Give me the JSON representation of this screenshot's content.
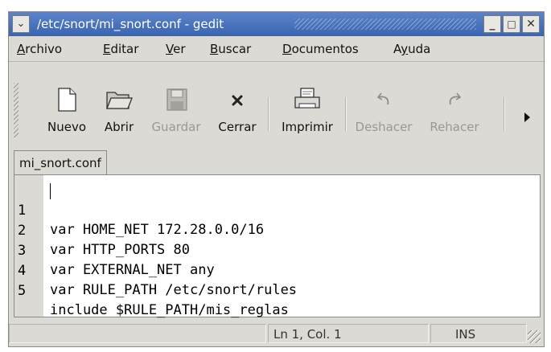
{
  "window": {
    "title": "/etc/snort/mi_snort.conf - gedit",
    "menu_glyph": "⌄",
    "minimize_glyph": "_",
    "maximize_glyph": "□",
    "close_glyph": "✕"
  },
  "menubar": {
    "items": [
      {
        "before": "",
        "mnemonic": "A",
        "after": "rchivo"
      },
      {
        "before": "",
        "mnemonic": "E",
        "after": "ditar"
      },
      {
        "before": "",
        "mnemonic": "V",
        "after": "er"
      },
      {
        "before": "",
        "mnemonic": "B",
        "after": "uscar"
      },
      {
        "before": "",
        "mnemonic": "D",
        "after": "ocumentos"
      },
      {
        "before": "A",
        "mnemonic": "y",
        "after": "uda"
      }
    ]
  },
  "toolbar": {
    "items": [
      {
        "label": "Nuevo",
        "icon": "new-document-icon",
        "enabled": true
      },
      {
        "label": "Abrir",
        "icon": "open-folder-icon",
        "enabled": true
      },
      {
        "label": "Guardar",
        "icon": "save-icon",
        "enabled": false
      },
      {
        "label": "Cerrar",
        "icon": "close-icon",
        "enabled": true
      },
      {
        "label": "Imprimir",
        "icon": "printer-icon",
        "enabled": true
      },
      {
        "label": "Deshacer",
        "icon": "undo-icon",
        "enabled": false
      },
      {
        "label": "Rehacer",
        "icon": "redo-icon",
        "enabled": false
      }
    ]
  },
  "tabs": [
    {
      "label": "mi_snort.conf"
    }
  ],
  "editor": {
    "lines": [
      {
        "n": "1",
        "text": "var HOME_NET 172.28.0.0/16"
      },
      {
        "n": "2",
        "text": "var HTTP_PORTS 80"
      },
      {
        "n": "3",
        "text": "var EXTERNAL_NET any"
      },
      {
        "n": "4",
        "text": "var RULE_PATH /etc/snort/rules"
      },
      {
        "n": "5",
        "text": "include $RULE_PATH/mis_reglas"
      }
    ]
  },
  "statusbar": {
    "position": "Ln 1, Col. 1",
    "mode": "INS"
  },
  "colors": {
    "titlebar": "#4a74bf",
    "window_bg": "#dcdad5",
    "disabled_text": "#9a9893"
  }
}
